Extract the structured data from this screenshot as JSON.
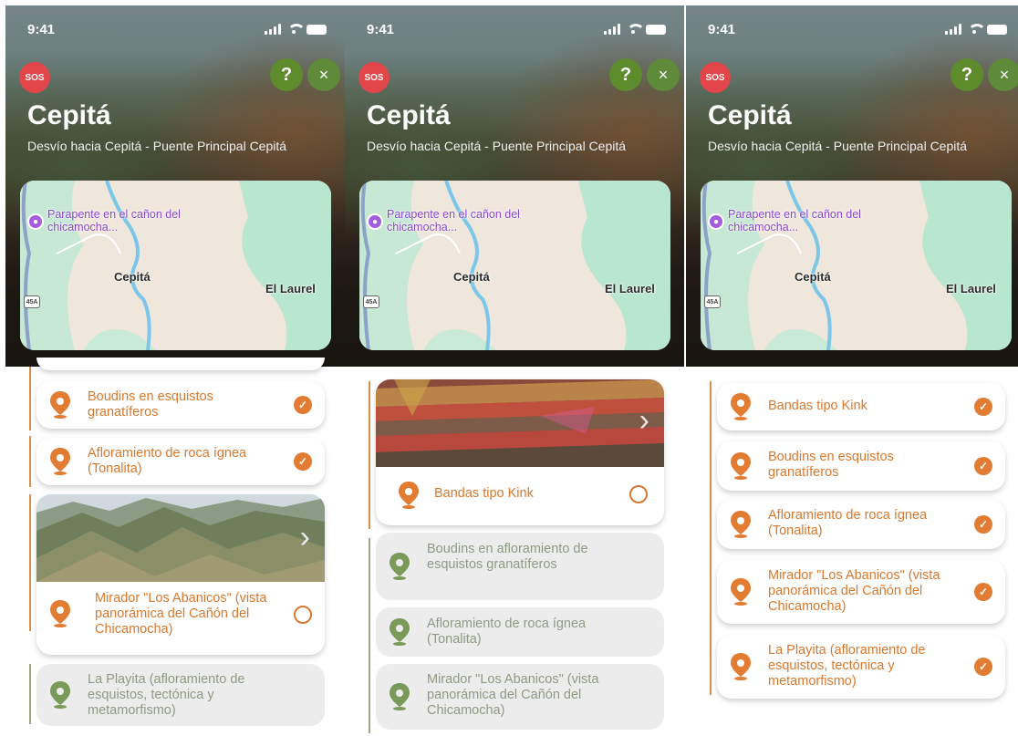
{
  "status": {
    "time": "9:41"
  },
  "header": {
    "sos": "SOS",
    "help": "?",
    "close": "×",
    "title": "Cepitá",
    "subtitle": "Desvío hacia Cepitá - Puente Principal Cepitá"
  },
  "map": {
    "poi_label": "Parapente en el cañon del chicamocha...",
    "place_1": "Cepitá",
    "place_2": "El Laurel",
    "route_shield": "45A"
  },
  "screen1": {
    "items": [
      {
        "label": "Boudins en esquistos granatíferos",
        "state": "done"
      },
      {
        "label": "Afloramiento de roca ígnea (Tonalita)",
        "state": "done"
      },
      {
        "label": "Mirador \"Los Abanicos\" (vista panorámica del Cañón del Chicamocha)",
        "state": "current"
      },
      {
        "label": "La Playita (afloramiento de esquistos, tectónica y metamorfismo)",
        "state": "locked"
      }
    ]
  },
  "screen2": {
    "items": [
      {
        "label": "Bandas tipo Kink",
        "state": "current"
      },
      {
        "label": "Boudins en afloramiento de esquistos granatíferos",
        "state": "locked"
      },
      {
        "label": "Afloramiento de roca ígnea (Tonalita)",
        "state": "locked"
      },
      {
        "label": "Mirador \"Los Abanicos\" (vista panorámica del Cañón del Chicamocha)",
        "state": "locked"
      }
    ]
  },
  "screen3": {
    "items": [
      {
        "label": "Bandas tipo Kink",
        "state": "done"
      },
      {
        "label": "Boudins en esquistos granatíferos",
        "state": "done"
      },
      {
        "label": "Afloramiento de roca ígnea (Tonalita)",
        "state": "done"
      },
      {
        "label": "Mirador \"Los Abanicos\" (vista panorámica del Cañón del Chicamocha)",
        "state": "done"
      },
      {
        "label": "La Playita (afloramiento de esquistos, tectónica y metamorfismo)",
        "state": "done"
      }
    ]
  },
  "colors": {
    "accent": "#e27c32",
    "sos": "#e2454a",
    "help": "#5e8c2d",
    "locked_pin": "#7a9a5a",
    "timeline": "#d98e4c"
  },
  "icons": {
    "sos": "sos-icon",
    "help": "help-icon",
    "close": "close-icon",
    "pin": "location-pin-icon",
    "check": "check-icon",
    "camera": "camera-icon",
    "next": "chevron-right-icon"
  }
}
